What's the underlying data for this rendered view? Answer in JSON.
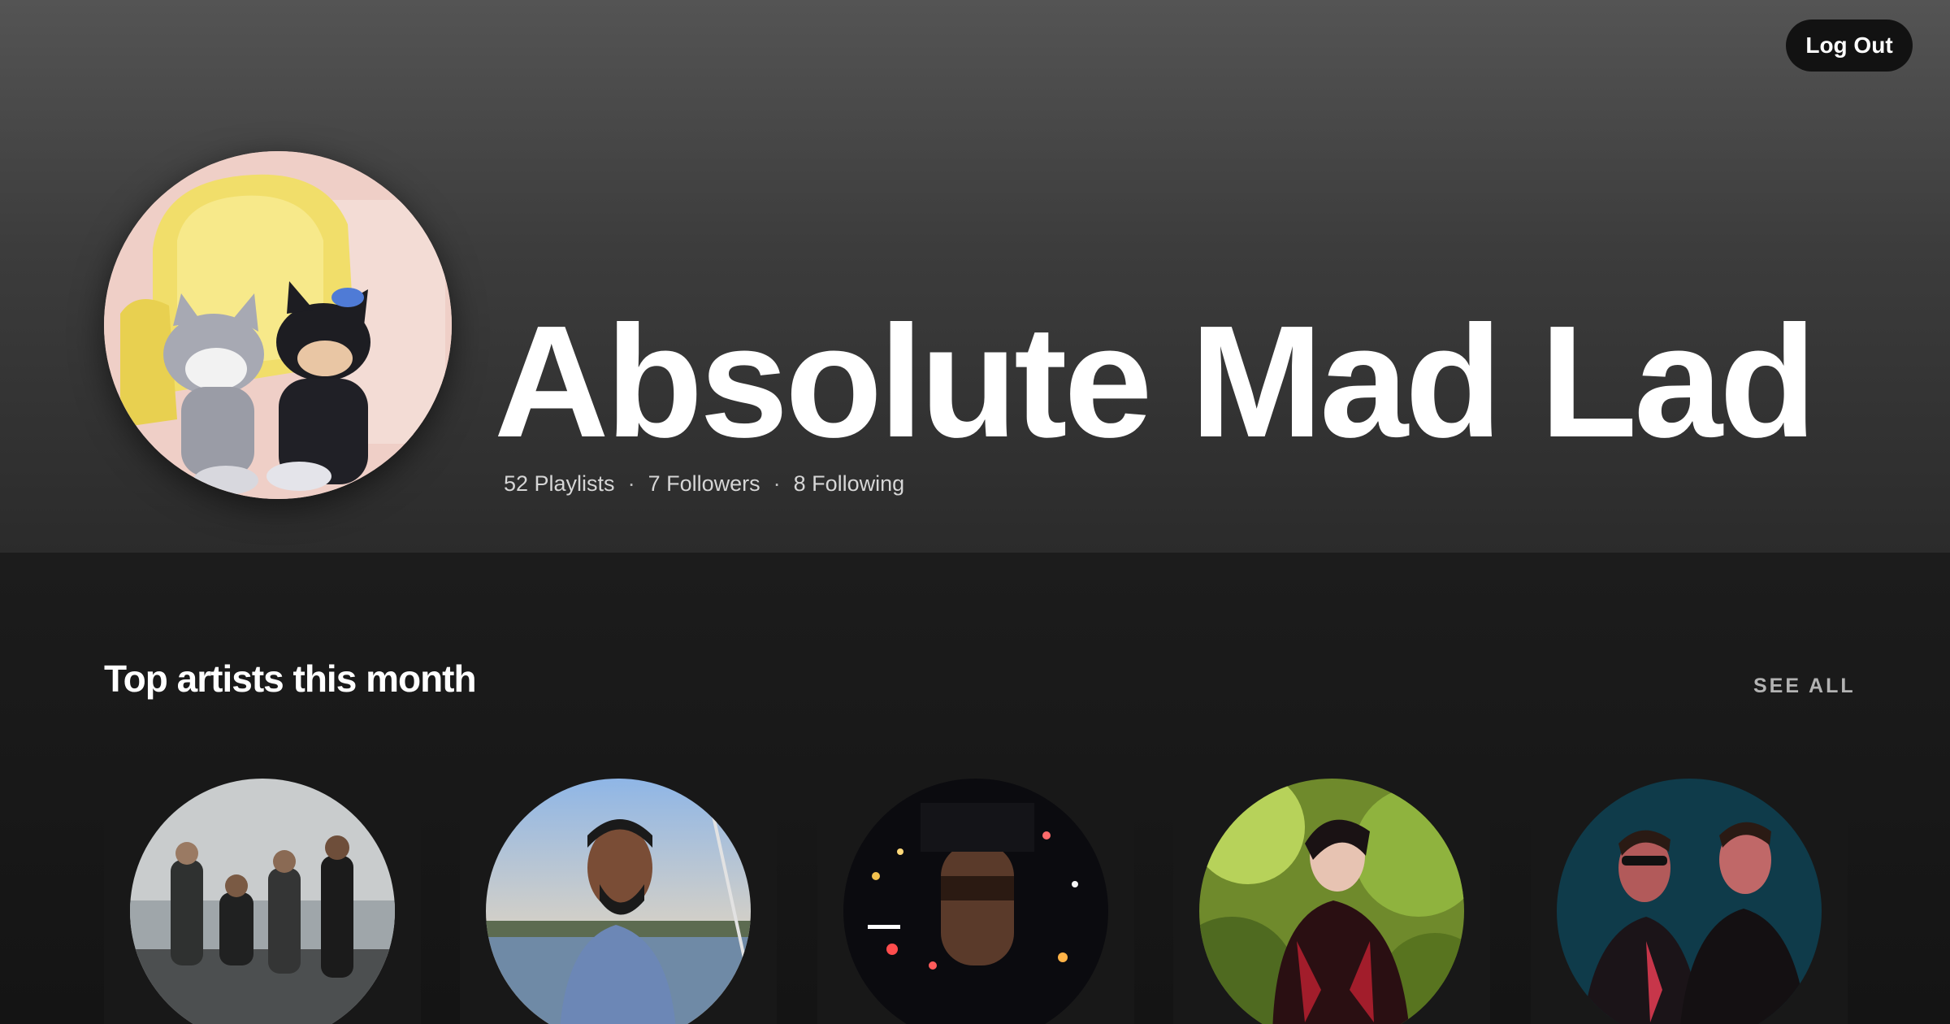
{
  "header": {
    "logout_label": "Log Out"
  },
  "profile": {
    "name": "Absolute Mad Lad",
    "avatar_alt": "profile-avatar",
    "stats": {
      "playlists": "52 Playlists",
      "followers": "7 Followers",
      "following": "8 Following",
      "separator": "·"
    }
  },
  "top_artists": {
    "title": "Top artists this month",
    "see_all_label": "SEE ALL",
    "artists": [
      {
        "image": "artist-photo-1"
      },
      {
        "image": "artist-photo-2"
      },
      {
        "image": "artist-photo-3"
      },
      {
        "image": "artist-photo-4"
      },
      {
        "image": "artist-photo-5"
      }
    ]
  },
  "colors": {
    "hero_top": "#545454",
    "hero_bottom": "#2b2b2b",
    "background": "#121212",
    "card": "#181818",
    "muted_text": "#b3b3b3"
  }
}
